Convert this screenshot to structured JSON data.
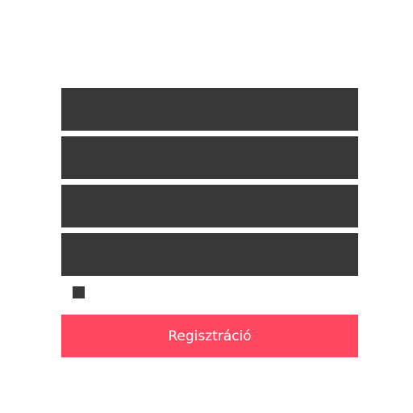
{
  "form": {
    "fields": [
      {
        "value": "",
        "placeholder": ""
      },
      {
        "value": "",
        "placeholder": ""
      },
      {
        "value": "",
        "placeholder": ""
      },
      {
        "value": "",
        "placeholder": ""
      }
    ],
    "checkbox_checked": false,
    "submit_label": "Regisztráció"
  },
  "colors": {
    "field_bg": "#383838",
    "accent": "#ff4860"
  }
}
